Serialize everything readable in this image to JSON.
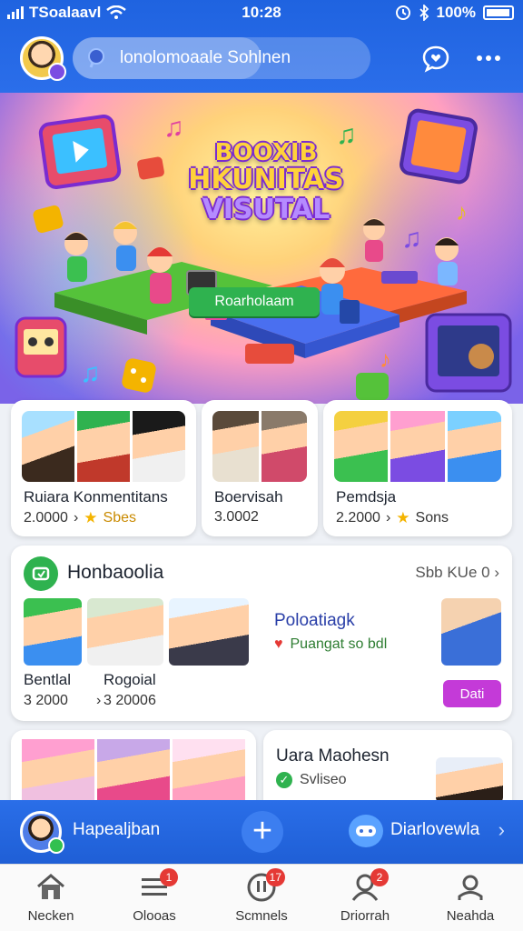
{
  "status_bar": {
    "carrier": "TSoalaavl",
    "time": "10:28",
    "battery": "100%"
  },
  "header": {
    "search_text": "lonolomoaale Sohlnen",
    "icons": [
      "avatar",
      "search-icon",
      "chat-heart-icon",
      "more-icon"
    ]
  },
  "hero": {
    "title_line1": "BOOXIB",
    "title_line2": "HKUNITAS",
    "title_line3": "VISUTAL",
    "button_label": "Roarholaam"
  },
  "cards": [
    {
      "title": "Ruiara Konmentitans",
      "count": "2.0000",
      "tag": "Sbes"
    },
    {
      "title": "Boervisah",
      "count": "3.0002",
      "tag": ""
    },
    {
      "title": "Pemdsja",
      "count": "2.2000",
      "tag": "Sons"
    }
  ],
  "section": {
    "title": "Honbaoolia",
    "see_all": "Sbb KUe 0",
    "items": [
      {
        "label": "Bentlal",
        "count": "3 2000"
      },
      {
        "label": "Rogoial",
        "count": "3 20006"
      }
    ],
    "featured_title": "Poloatiagk",
    "featured_sub": "Puangat so bdl",
    "button_label": "Dati"
  },
  "lower": {
    "card_title": "Uara Maohesn",
    "card_sub": "Svliseo"
  },
  "profile_bar": {
    "name": "Hapealjban",
    "right_label": "Diarlovewla"
  },
  "bottom_nav": [
    {
      "label": "Necken",
      "icon": "home-icon",
      "badge": ""
    },
    {
      "label": "Olooas",
      "icon": "list-icon",
      "badge": "1"
    },
    {
      "label": "Scmnels",
      "icon": "alert-icon",
      "badge": "17"
    },
    {
      "label": "Driorrah",
      "icon": "people-icon",
      "badge": "2"
    },
    {
      "label": "Neahda",
      "icon": "person-icon",
      "badge": ""
    }
  ],
  "colors": {
    "header_blue": "#2368e4",
    "accent_green": "#2fb24f",
    "accent_purple": "#c43ad8",
    "badge_red": "#e53935"
  }
}
